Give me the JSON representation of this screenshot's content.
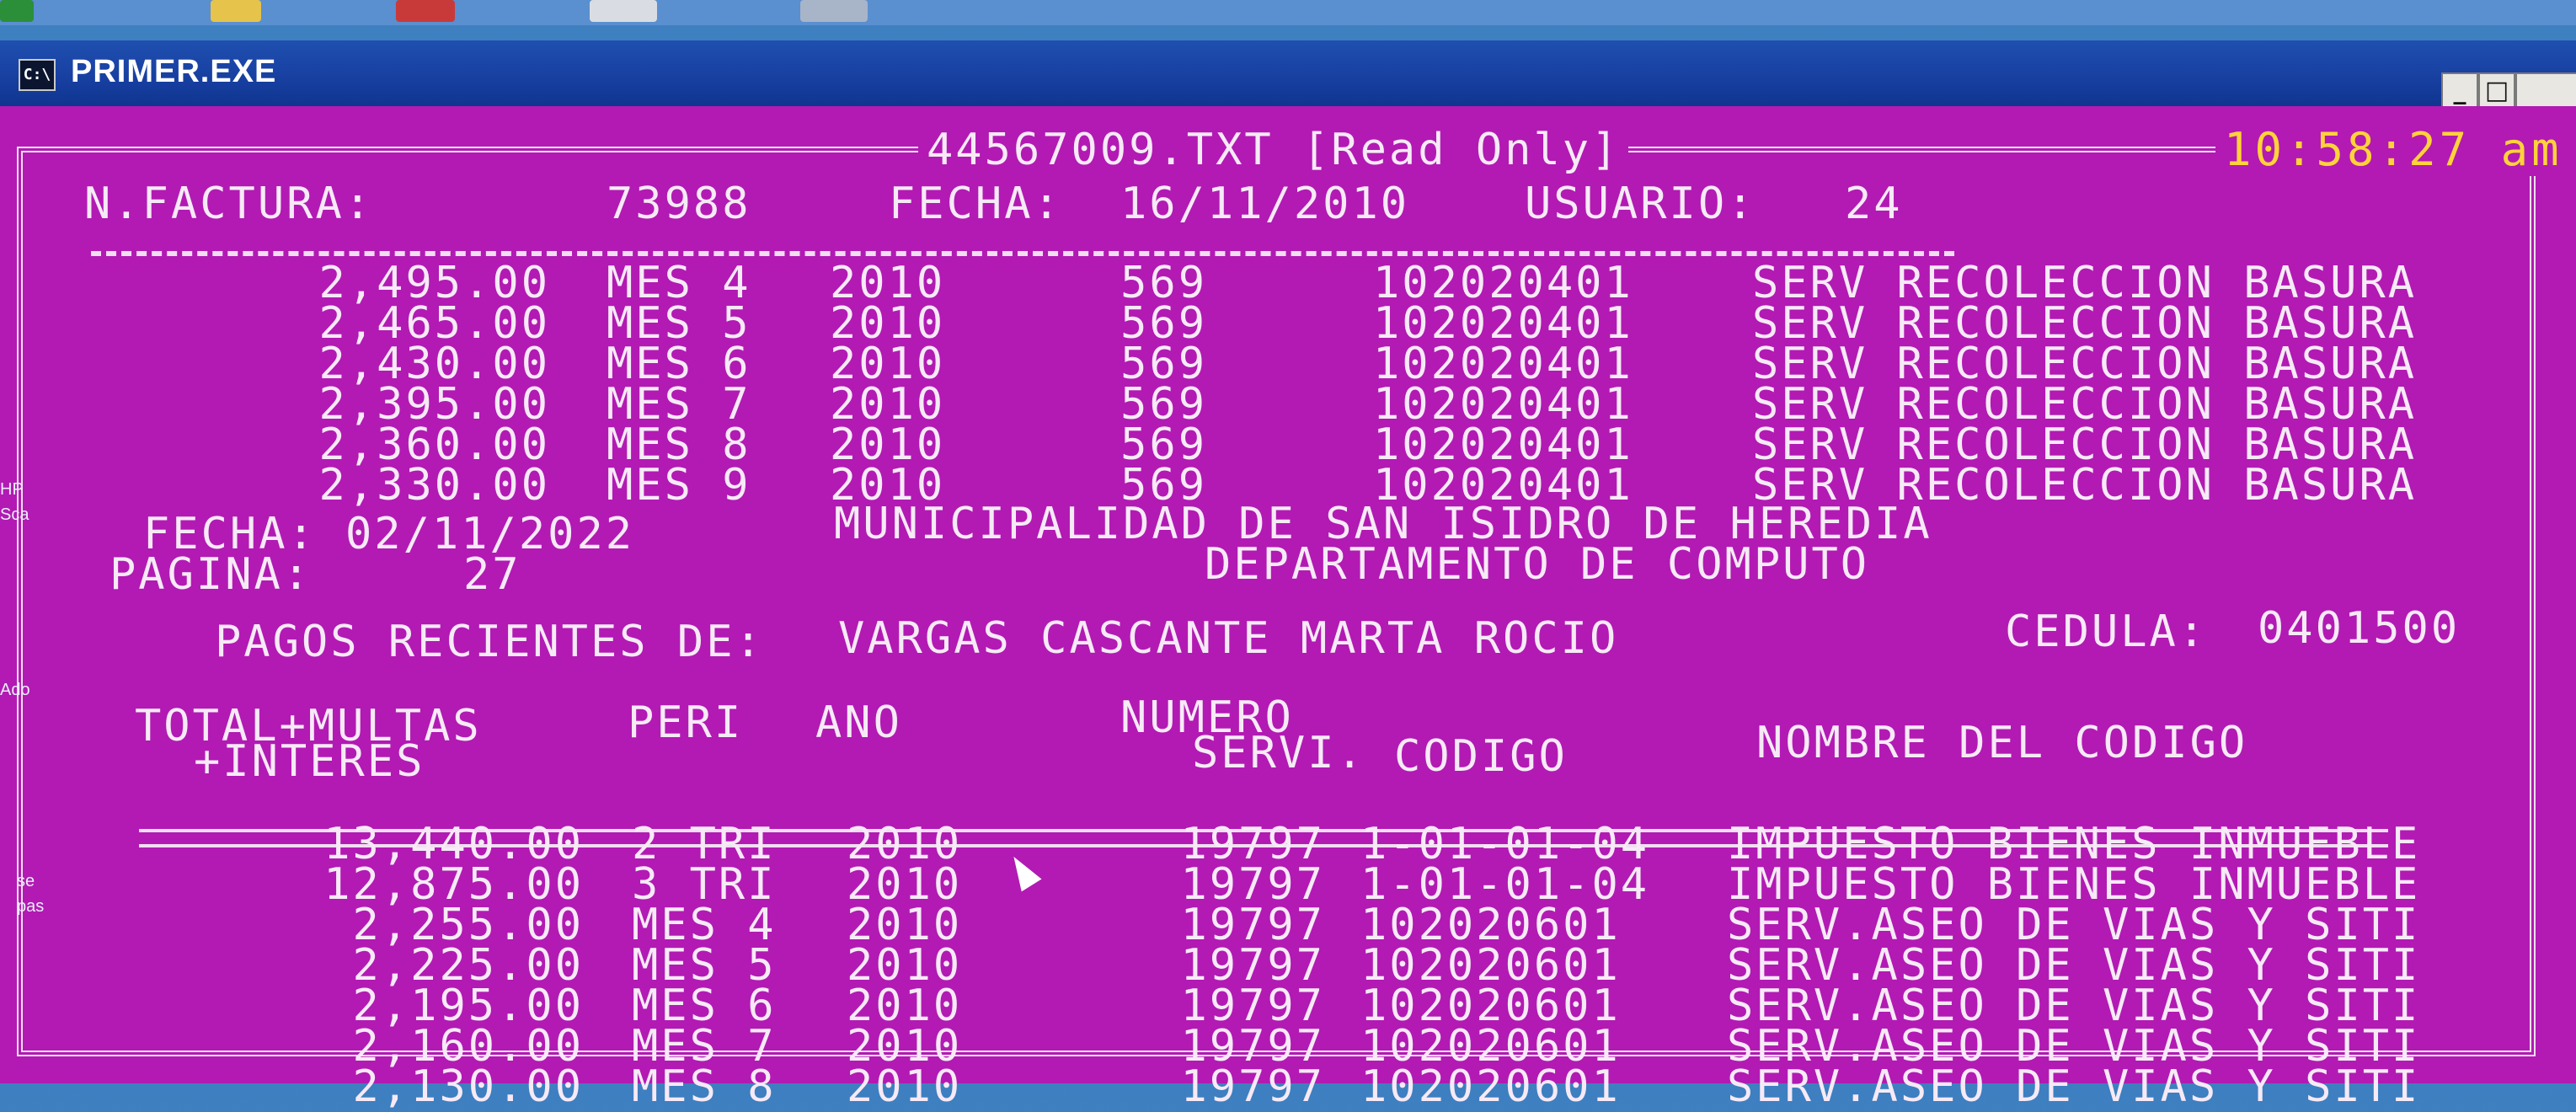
{
  "window": {
    "title": "PRIMER.EXE",
    "icon_text": "C:\\"
  },
  "header": {
    "file_title": "44567009.TXT [Read Only]",
    "clock": "10:58:27 am",
    "invoice_label": "N.FACTURA:",
    "invoice_number": "73988",
    "date_label": "FECHA:",
    "date": "16/11/2010",
    "user_label": "USUARIO:",
    "user": "24"
  },
  "upper_rows": [
    {
      "amount": "2,495.00",
      "period": "MES 4",
      "year": "2010",
      "service": "569",
      "code": "102020401",
      "name": "SERV RECOLECCION BASURA"
    },
    {
      "amount": "2,465.00",
      "period": "MES 5",
      "year": "2010",
      "service": "569",
      "code": "102020401",
      "name": "SERV RECOLECCION BASURA"
    },
    {
      "amount": "2,430.00",
      "period": "MES 6",
      "year": "2010",
      "service": "569",
      "code": "102020401",
      "name": "SERV RECOLECCION BASURA"
    },
    {
      "amount": "2,395.00",
      "period": "MES 7",
      "year": "2010",
      "service": "569",
      "code": "102020401",
      "name": "SERV RECOLECCION BASURA"
    },
    {
      "amount": "2,360.00",
      "period": "MES 8",
      "year": "2010",
      "service": "569",
      "code": "102020401",
      "name": "SERV RECOLECCION BASURA"
    },
    {
      "amount": "2,330.00",
      "period": "MES 9",
      "year": "2010",
      "service": "569",
      "code": "102020401",
      "name": "SERV RECOLECCION BASURA"
    }
  ],
  "report": {
    "date_label": "FECHA:",
    "date": "02/11/2022",
    "org": "MUNICIPALIDAD DE SAN ISIDRO DE HEREDIA",
    "page_label": "PAGINA:",
    "page": "27",
    "dept": "DEPARTAMENTO DE COMPUTO",
    "payments_label": "PAGOS RECIENTES DE:",
    "payer": "VARGAS CASCANTE MARTA ROCIO",
    "id_label": "CEDULA:",
    "id": "0401500"
  },
  "columns": {
    "total_1": "TOTAL+MULTAS",
    "total_2": "+INTERES",
    "period": "PERI",
    "year": "ANO",
    "service_1": "NUMERO",
    "service_2": "SERVI.",
    "code": "CODIGO",
    "name": "NOMBRE DEL CODIGO"
  },
  "lower_rows": [
    {
      "amount": "13,440.00",
      "period": "2 TRI",
      "year": "2010",
      "service": "19797",
      "code": "1-01-01-04",
      "name": "IMPUESTO BIENES INMUEBLE"
    },
    {
      "amount": "12,875.00",
      "period": "3 TRI",
      "year": "2010",
      "service": "19797",
      "code": "1-01-01-04",
      "name": "IMPUESTO BIENES INMUEBLE"
    },
    {
      "amount": "2,255.00",
      "period": "MES 4",
      "year": "2010",
      "service": "19797",
      "code": "102020601",
      "name": "SERV.ASEO DE VIAS Y SITI"
    },
    {
      "amount": "2,225.00",
      "period": "MES 5",
      "year": "2010",
      "service": "19797",
      "code": "102020601",
      "name": "SERV.ASEO DE VIAS Y SITI"
    },
    {
      "amount": "2,195.00",
      "period": "MES 6",
      "year": "2010",
      "service": "19797",
      "code": "102020601",
      "name": "SERV.ASEO DE VIAS Y SITI"
    },
    {
      "amount": "2,160.00",
      "period": "MES 7",
      "year": "2010",
      "service": "19797",
      "code": "102020601",
      "name": "SERV.ASEO DE VIAS Y SITI"
    },
    {
      "amount": "2,130.00",
      "period": "MES 8",
      "year": "2010",
      "service": "19797",
      "code": "102020601",
      "name": "SERV.ASEO DE VIAS Y SITI"
    }
  ],
  "desktop": {
    "label_hp": "HP",
    "label_sca": "Sca",
    "label_ado": "Ado",
    "label_se": "se",
    "label_pas": "pas"
  },
  "colors": {
    "console_bg": "#b21ab3",
    "console_fg": "#f6eaf6",
    "clock": "#ffd23a",
    "titlebar": "#173fa0"
  }
}
